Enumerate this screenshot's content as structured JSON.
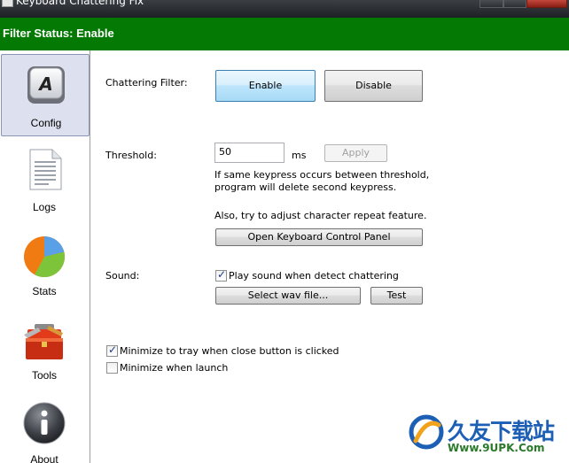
{
  "window": {
    "title": "Keyboard Chattering Fix"
  },
  "status": {
    "text": "Filter Status: Enable"
  },
  "sidebar": {
    "items": [
      {
        "label": "Config",
        "icon": "keyboard-key-a-icon",
        "selected": true
      },
      {
        "label": "Logs",
        "icon": "document-icon"
      },
      {
        "label": "Stats",
        "icon": "pie-chart-icon"
      },
      {
        "label": "Tools",
        "icon": "toolbox-icon"
      },
      {
        "label": "About",
        "icon": "info-icon"
      }
    ]
  },
  "filter": {
    "label": "Chattering Filter:",
    "enable_label": "Enable",
    "disable_label": "Disable"
  },
  "threshold": {
    "label": "Threshold:",
    "value": "50",
    "unit": "ms",
    "apply_label": "Apply",
    "help_line1": "If same keypress occurs between threshold,",
    "help_line2": "program will delete second keypress.",
    "repeat_hint": "Also, try to adjust character repeat feature.",
    "control_panel_label": "Open Keyboard Control Panel"
  },
  "sound": {
    "label": "Sound:",
    "play_sound_label": "Play sound when detect chattering",
    "play_sound_checked": true,
    "select_file_label": "Select wav file...",
    "test_label": "Test"
  },
  "options": {
    "minimize_tray_label": "Minimize to tray when close button is clicked",
    "minimize_tray_checked": true,
    "minimize_launch_label": "Minimize when launch",
    "minimize_launch_checked": false
  },
  "watermark": {
    "title": "久友下载站",
    "url": "Www.9UPK.Com"
  },
  "colors": {
    "status_green": "#047a04",
    "selected_nav": "#dde0ee",
    "primary_button": "#bee6fd"
  }
}
